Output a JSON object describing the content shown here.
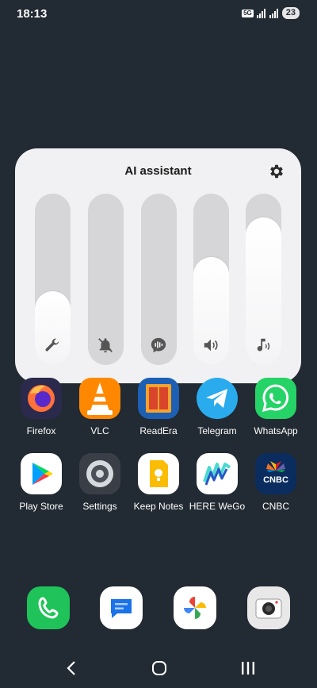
{
  "status": {
    "time": "18:13",
    "network": "5G",
    "battery": "23"
  },
  "volume_panel": {
    "title": "AI assistant",
    "sliders": [
      {
        "name": "assistant",
        "level": 0.43,
        "icon": "wrench-icon"
      },
      {
        "name": "notifications",
        "level": 0.0,
        "icon": "bell-muted-icon"
      },
      {
        "name": "voice",
        "level": 0.0,
        "icon": "voice-icon"
      },
      {
        "name": "system",
        "level": 0.63,
        "icon": "speaker-icon"
      },
      {
        "name": "media",
        "level": 0.86,
        "icon": "music-note-icon"
      }
    ]
  },
  "apps": {
    "row1": [
      {
        "label": "Firefox",
        "color": "#2b2a4c"
      },
      {
        "label": "VLC",
        "color": "#ff8800"
      },
      {
        "label": "ReadEra",
        "color": "#1d5fb3"
      },
      {
        "label": "Telegram",
        "color": "#2aabee"
      },
      {
        "label": "WhatsApp",
        "color": "#25d366"
      }
    ],
    "row2": [
      {
        "label": "Play Store",
        "color": "#ffffff"
      },
      {
        "label": "Settings",
        "color": "#3a3f47"
      },
      {
        "label": "Keep Notes",
        "color": "#ffffff"
      },
      {
        "label": "HERE WeGo",
        "color": "#ffffff"
      },
      {
        "label": "CNBC",
        "color": "#0a2c5e"
      }
    ]
  },
  "dock": [
    {
      "name": "phone",
      "color": "#1fc35a"
    },
    {
      "name": "messages",
      "color": "#ffffff"
    },
    {
      "name": "photos",
      "color": "#ffffff"
    },
    {
      "name": "camera",
      "color": "#e8e8e8"
    }
  ]
}
